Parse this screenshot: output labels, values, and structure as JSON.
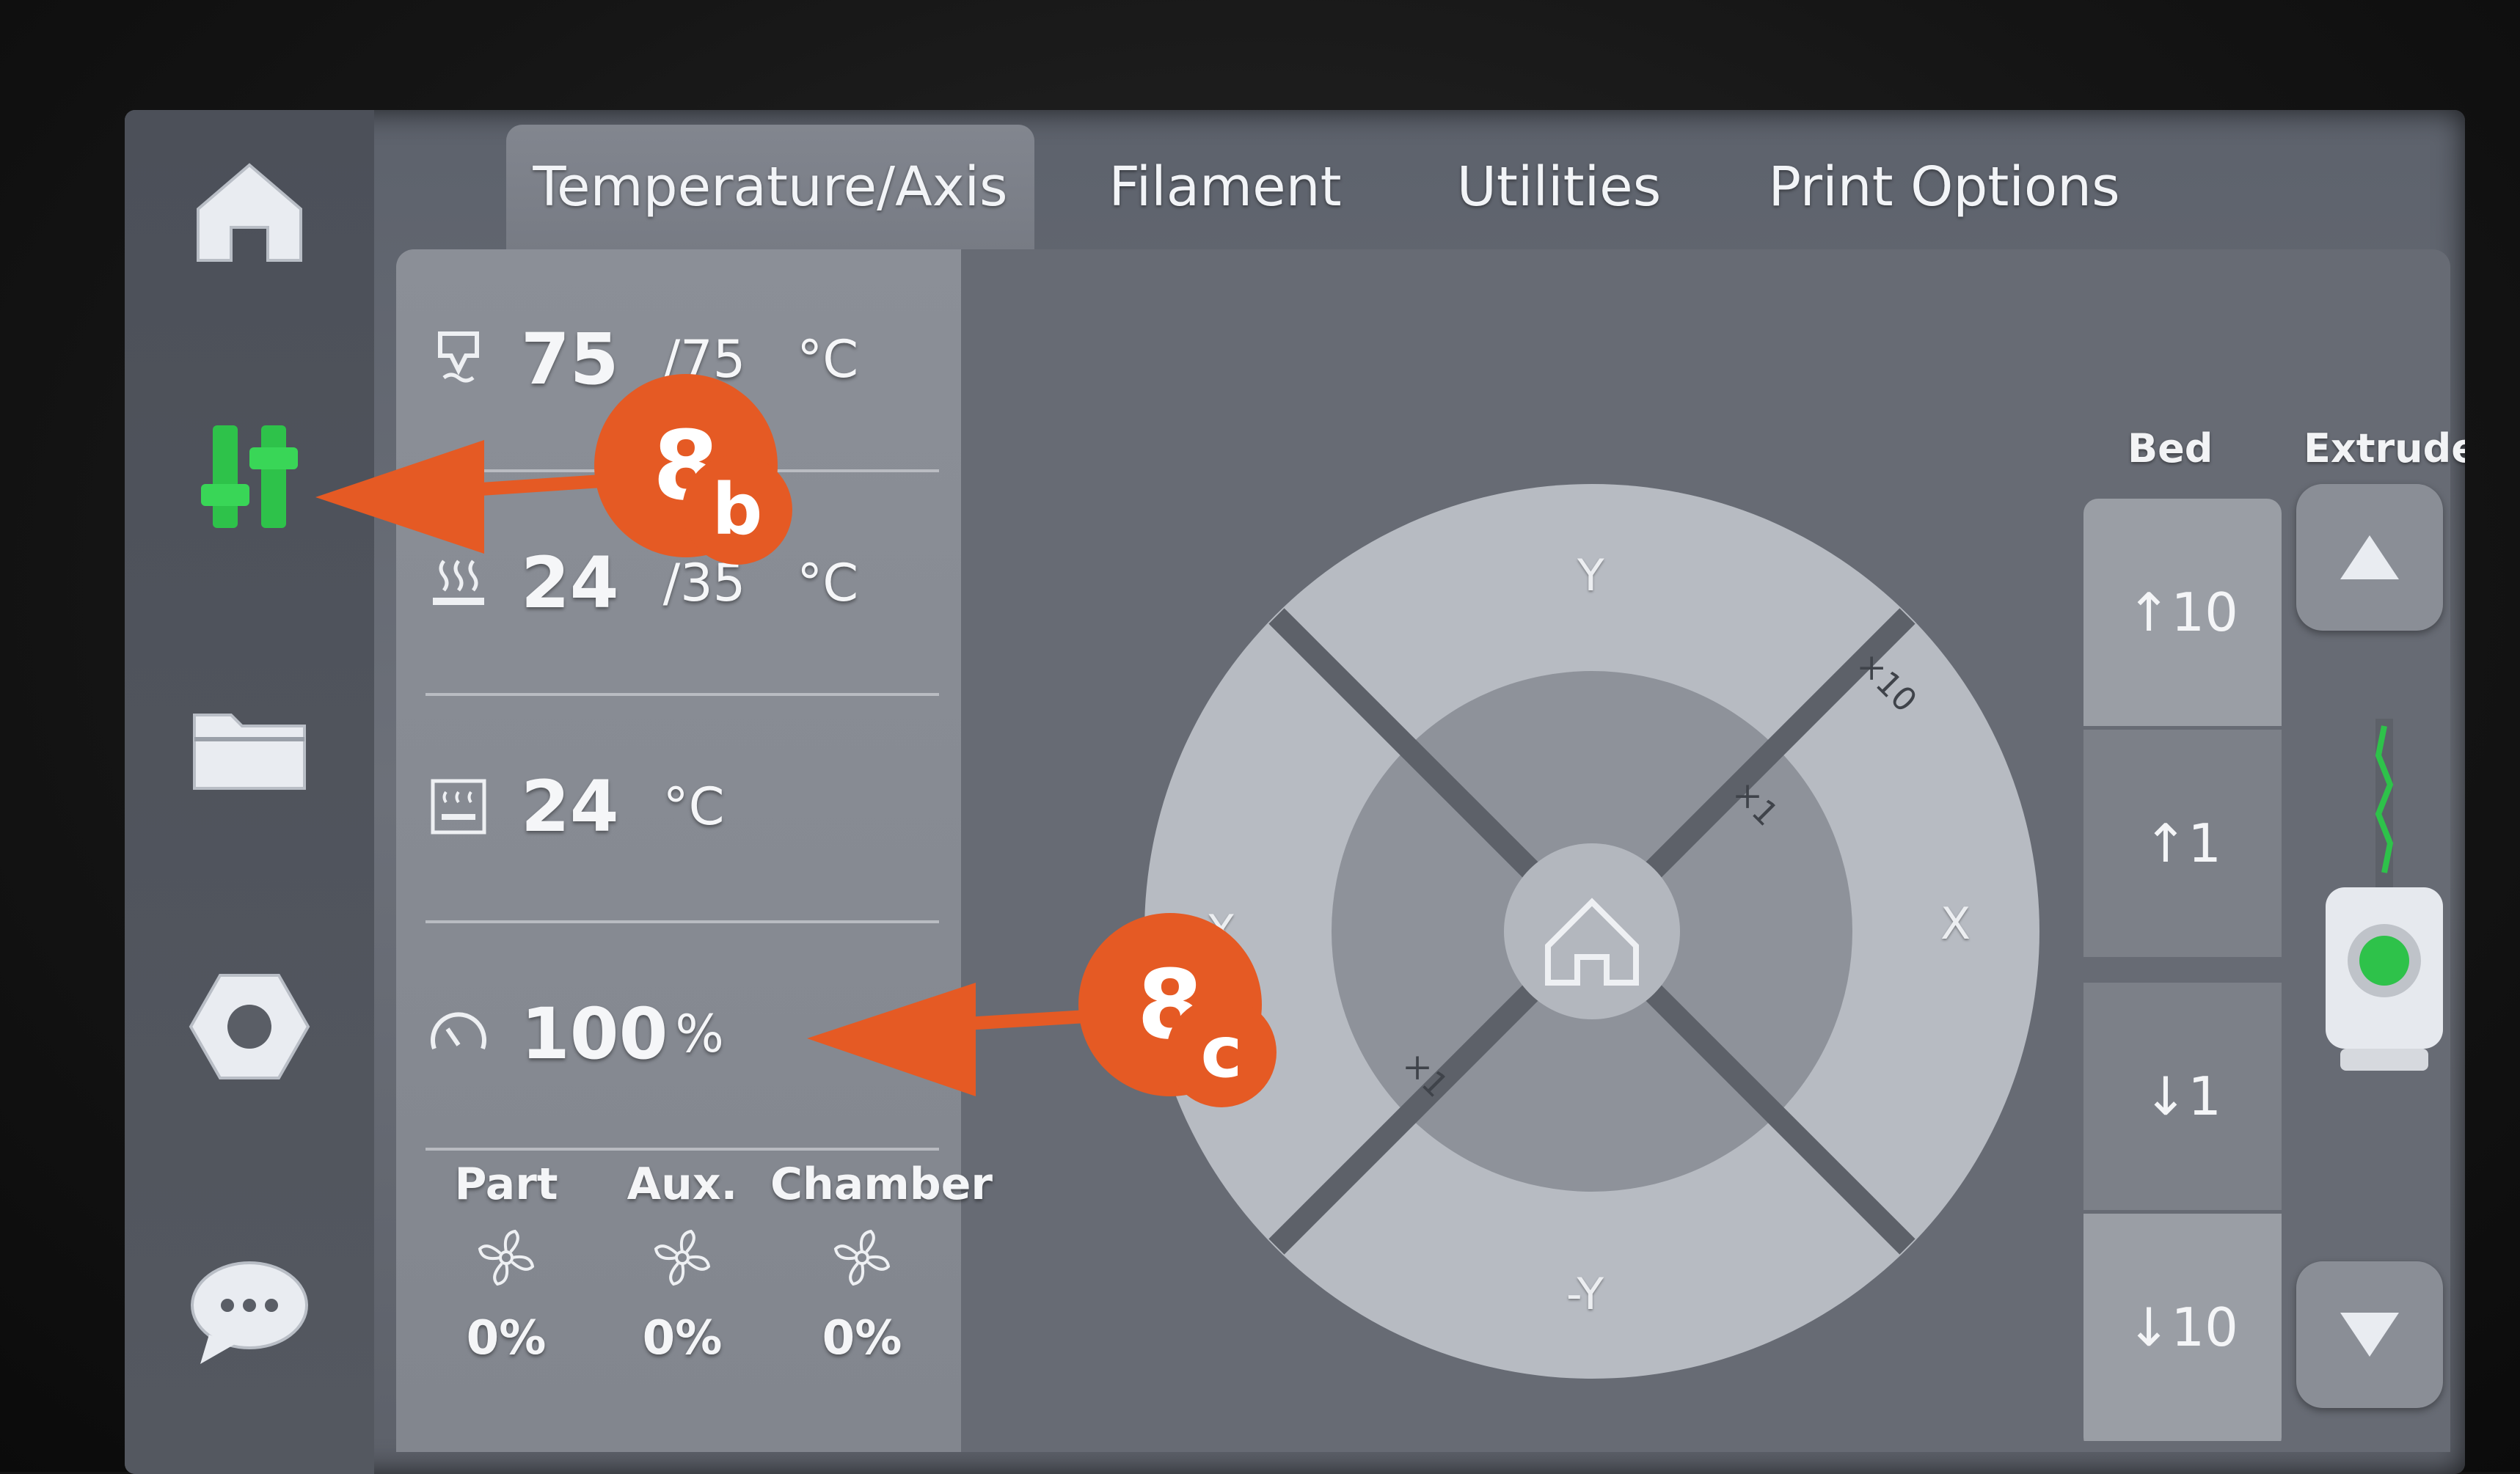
{
  "tabs": [
    {
      "label": "Temperature/Axis",
      "active": true
    },
    {
      "label": "Filament",
      "active": false
    },
    {
      "label": "Utilities",
      "active": false
    },
    {
      "label": "Print Options",
      "active": false
    }
  ],
  "sidebar": {
    "items": [
      {
        "name": "home",
        "icon": "home-icon"
      },
      {
        "name": "controls",
        "icon": "sliders-icon",
        "active": true
      },
      {
        "name": "files",
        "icon": "folder-icon"
      },
      {
        "name": "settings",
        "icon": "hex-nut-icon"
      },
      {
        "name": "messages",
        "icon": "chat-icon"
      }
    ]
  },
  "temperatures": {
    "nozzle": {
      "current": "75",
      "target": "/75",
      "unit": "°C"
    },
    "bed": {
      "current": "24",
      "target": "/35",
      "unit": "°C"
    },
    "chamber": {
      "current": "24",
      "unit": "°C"
    },
    "speed": {
      "value": "100",
      "unit": "%"
    }
  },
  "fans": [
    {
      "label": "Part",
      "value": "0%"
    },
    {
      "label": "Aux.",
      "value": "0%"
    },
    {
      "label": "Chamber",
      "value": "0%"
    }
  ],
  "axis_dial": {
    "labels": {
      "y_plus": "Y",
      "y_minus": "-Y",
      "x_plus": "X",
      "x_minus": "-X"
    },
    "steps": {
      "outer": "×10",
      "inner": "×1",
      "inner_neg": "×1"
    }
  },
  "bed_controls": {
    "header": "Bed",
    "buttons": [
      {
        "label": "10",
        "direction": "up"
      },
      {
        "label": "1",
        "direction": "up"
      },
      {
        "label": "1",
        "direction": "down"
      },
      {
        "label": "10",
        "direction": "down"
      }
    ]
  },
  "extruder_controls": {
    "header": "Extruder"
  },
  "annotations": [
    {
      "number": "8",
      "letter": "b"
    },
    {
      "number": "8",
      "letter": "c"
    }
  ],
  "colors": {
    "accent_green": "#2ec24a",
    "callout": "#e55a24"
  }
}
